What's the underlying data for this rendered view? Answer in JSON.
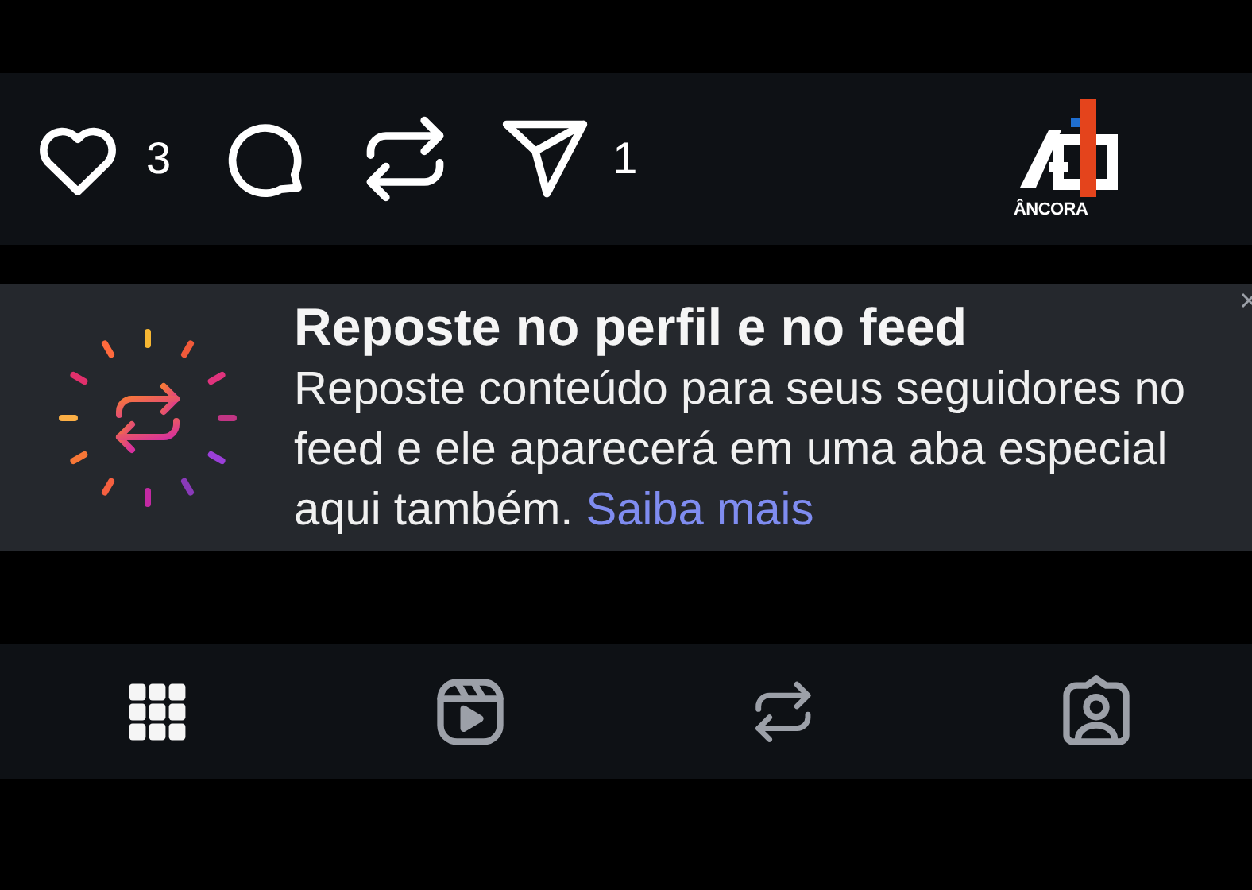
{
  "actions": [
    {
      "kind": "like",
      "count": "3"
    },
    {
      "kind": "comment"
    },
    {
      "kind": "repost"
    },
    {
      "kind": "share",
      "count": "1"
    }
  ],
  "logo": {
    "text": "ÂNCORA"
  },
  "banner": {
    "title": "Reposte no perfil e no feed",
    "body": "Reposte conteúdo para seus seguidores no feed e ele aparecerá em uma aba especial aqui também.",
    "link": "Saiba mais"
  },
  "tabs": [
    {
      "kind": "grid",
      "selected": true
    },
    {
      "kind": "reels",
      "selected": false
    },
    {
      "kind": "reposts",
      "selected": false
    },
    {
      "kind": "tagged",
      "selected": false
    }
  ]
}
